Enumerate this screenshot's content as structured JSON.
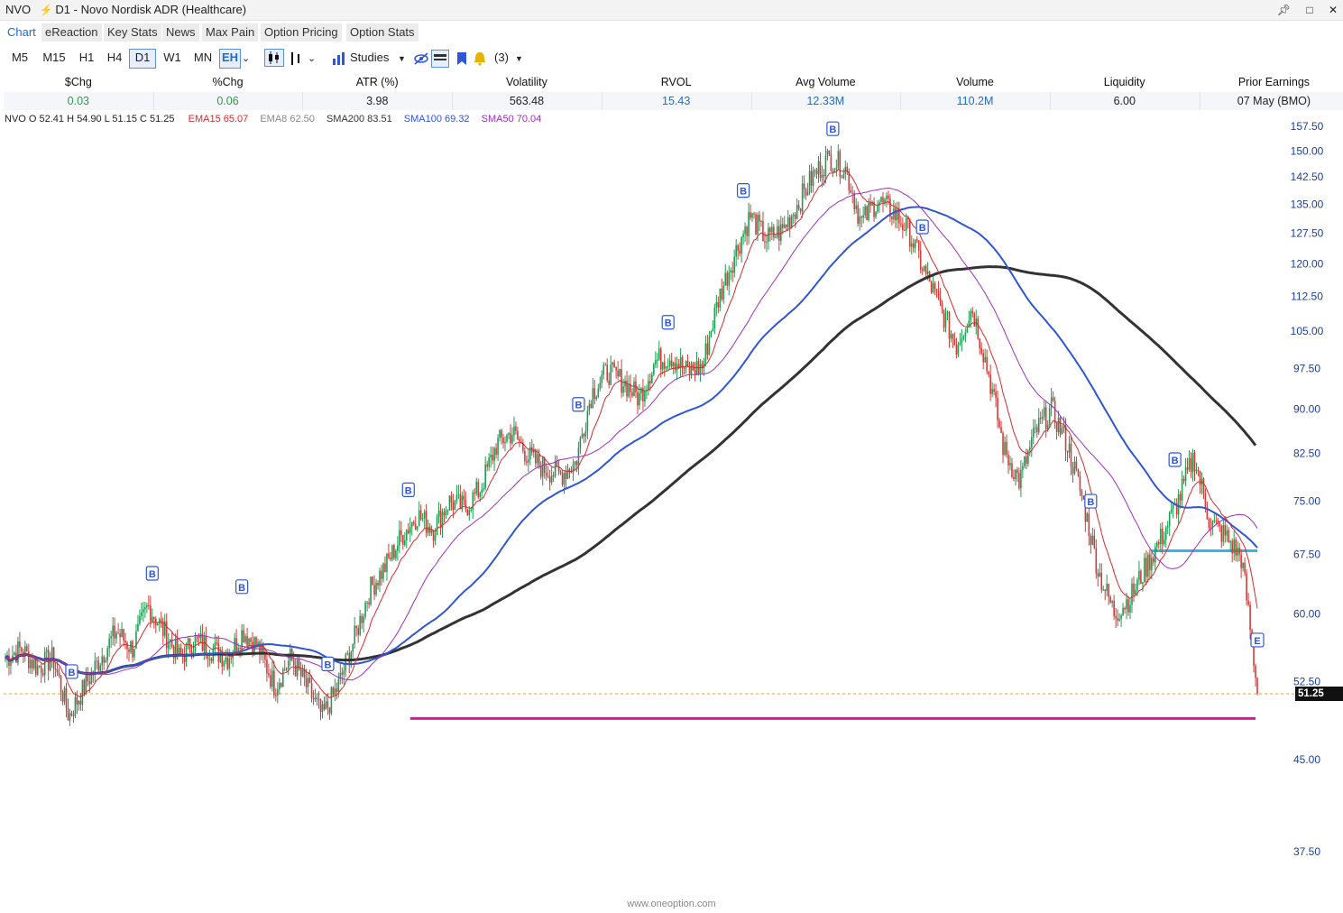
{
  "window": {
    "title_symbol": "NVO",
    "title_rest": "D1 - Novo Nordisk ADR (Healthcare)"
  },
  "tabs": [
    "Chart",
    "eReaction",
    "Key Stats",
    "News",
    "Max Pain",
    "Option Pricing",
    "Option Stats"
  ],
  "toolbar": {
    "timeframes": [
      "M5",
      "M15",
      "H1",
      "H4",
      "D1",
      "W1",
      "MN",
      "EH"
    ],
    "active_timeframe": "D1",
    "studies_label": "Studies",
    "alerts_count": "(3)"
  },
  "stats": {
    "headers": [
      "$Chg",
      "%Chg",
      "ATR (%)",
      "Volatility",
      "RVOL",
      "Avg Volume",
      "Volume",
      "Liquidity",
      "Prior Earnings"
    ],
    "values": [
      "0.03",
      "0.06",
      "3.98",
      "563.48",
      "15.43",
      "12.33M",
      "110.2M",
      "6.00",
      "07 May (BMO)"
    ],
    "value_colors": [
      "#2a9d4a",
      "#2a9d4a",
      "#222222",
      "#222222",
      "#1a6dd9",
      "#1a6dd9",
      "#1a6dd9",
      "#222222",
      "#222222"
    ]
  },
  "legend": {
    "ohlc": "NVO  O 52.41  H 54.90  L 51.15  C 51.25",
    "ema15": "EMA15  65.07",
    "ema8": "EMA8  62.50",
    "sma200": "SMA200  83.51",
    "sma100": "SMA100  69.32",
    "sma50": "SMA50  70.04",
    "colors": {
      "ema15": "#d92b2b",
      "ema8": "#888888",
      "sma200": "#333333",
      "sma100": "#2f56d6",
      "sma50": "#9b30c4"
    }
  },
  "price_axis": {
    "ticks": [
      "157.50",
      "150.00",
      "142.50",
      "135.00",
      "127.50",
      "120.00",
      "112.50",
      "105.00",
      "97.50",
      "90.00",
      "82.50",
      "75.00",
      "67.50",
      "60.00",
      "52.50",
      "45.00",
      "37.50"
    ],
    "last_price": "51.25"
  },
  "chart_data": {
    "type": "candlestick",
    "symbol": "NVO",
    "timeframe": "D1",
    "y_scale": "log",
    "ylim": [
      37.5,
      157.5
    ],
    "close_path_approx": [
      55,
      56,
      54,
      55,
      49,
      52,
      55,
      58,
      56,
      61,
      58,
      55,
      57,
      56,
      55,
      58,
      56,
      52,
      55,
      52,
      49,
      52,
      57,
      63,
      66,
      70,
      73,
      71,
      75,
      74,
      77,
      84,
      86,
      82,
      80,
      79,
      81,
      93,
      97,
      95,
      92,
      99,
      100,
      97,
      98,
      112,
      122,
      132,
      126,
      128,
      135,
      143,
      148,
      145,
      130,
      136,
      133,
      128,
      118,
      110,
      102,
      110,
      97,
      83,
      78,
      86,
      90,
      84,
      75,
      65,
      60,
      62,
      66,
      70,
      75,
      82,
      72,
      70,
      67,
      51.25
    ],
    "moving_averages": [
      {
        "name": "EMA15",
        "last": 65.07,
        "color": "#d92b2b"
      },
      {
        "name": "EMA8",
        "last": 62.5,
        "color": "#888888"
      },
      {
        "name": "SMA200",
        "last": 83.51,
        "color": "#333333"
      },
      {
        "name": "SMA100",
        "last": 69.32,
        "color": "#2f56d6"
      },
      {
        "name": "SMA50",
        "last": 70.04,
        "color": "#9b30c4"
      }
    ],
    "levels": [
      {
        "price": 48.8,
        "color": "#d6199a"
      },
      {
        "price": 68.0,
        "color": "#33b4f0"
      },
      {
        "price": 51.25,
        "color": "#e8a23a",
        "style": "dashed"
      }
    ],
    "markers_label": "B",
    "markers_last_label": "E",
    "grid": false
  },
  "watermark": "www.oneoption.com"
}
